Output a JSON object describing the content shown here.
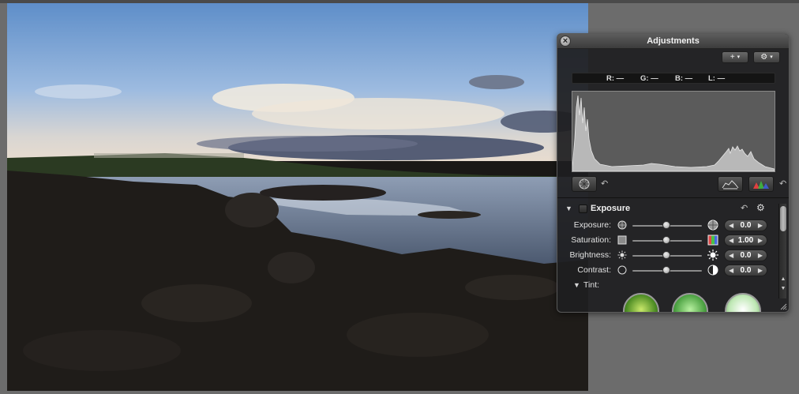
{
  "hud": {
    "title": "Adjustments",
    "close_glyph": "×",
    "add_button_label": "+",
    "gear_button_label": "⚙",
    "caret_glyph": "▾",
    "info": {
      "r": "R: —",
      "g": "G: —",
      "b": "B: —",
      "l": "L: —"
    },
    "section": {
      "title": "Exposure",
      "rows": [
        {
          "label": "Exposure:",
          "value": "0.0"
        },
        {
          "label": "Saturation:",
          "value": "1.00"
        },
        {
          "label": "Brightness:",
          "value": "0.0"
        },
        {
          "label": "Contrast:",
          "value": "0.0"
        }
      ],
      "tint_label": "Tint:"
    },
    "stepper_left_glyph": "◀",
    "stepper_right_glyph": "▶",
    "undo_glyph": "↶",
    "icons": {
      "close": "close-icon",
      "add": "plus-icon",
      "gear": "gear-icon",
      "auto_levels": "aperture-icon",
      "levels": "levels-icon",
      "rgb_levels": "rgb-levels-icon",
      "undo": "undo-icon"
    },
    "colors": {
      "panel_bg": "#1e1e20",
      "histogram_bg": "#5b5b5b",
      "histogram_fill": "#b8b8b8"
    }
  }
}
